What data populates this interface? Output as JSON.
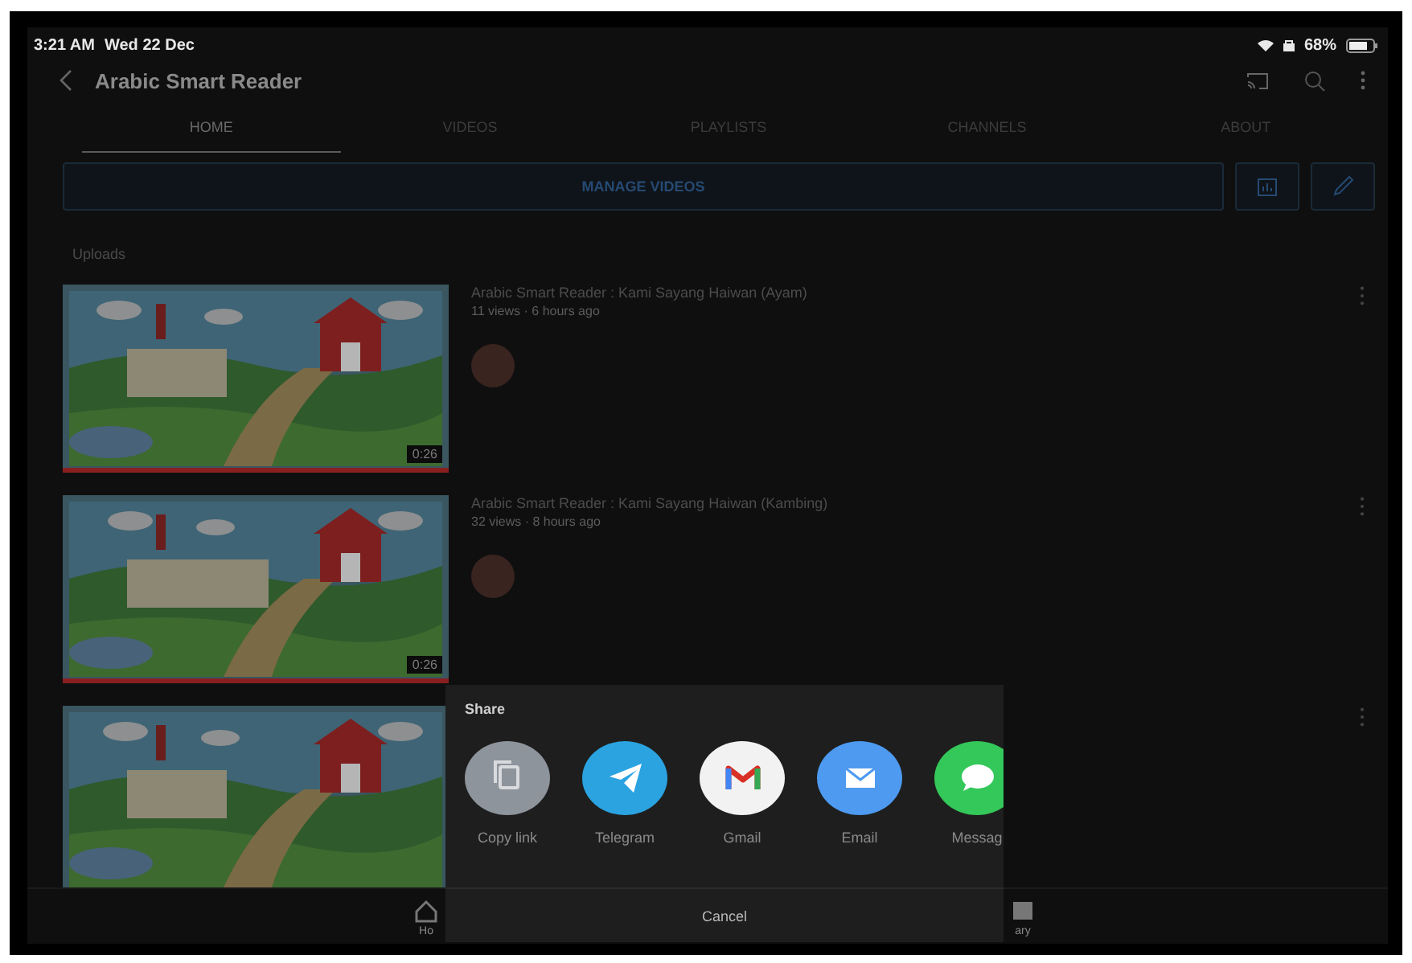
{
  "status_bar": {
    "time": "3:21 AM",
    "date": "Wed 22 Dec",
    "battery": "68%"
  },
  "header": {
    "title": "Arabic Smart Reader"
  },
  "tabs": [
    {
      "label": "HOME",
      "selected": true
    },
    {
      "label": "VIDEOS",
      "selected": false
    },
    {
      "label": "PLAYLISTS",
      "selected": false
    },
    {
      "label": "CHANNELS",
      "selected": false
    },
    {
      "label": "ABOUT",
      "selected": false
    }
  ],
  "manage_button": "MANAGE VIDEOS",
  "section_title": "Uploads",
  "videos": [
    {
      "title": "Arabic Smart Reader : Kami Sayang Haiwan (Ayam)",
      "meta": "11 views · 6 hours ago",
      "duration": "0:26",
      "kind": "picture"
    },
    {
      "title": "Arabic Smart Reader : Kami Sayang Haiwan (Kambing)",
      "meta": "32 views · 8 hours ago",
      "duration": "0:26",
      "kind": "picture"
    },
    {
      "kind": "picture"
    }
  ],
  "bottom_nav": [
    {
      "label": "Ho",
      "kind": "home"
    },
    {
      "label": "ary",
      "kind": "library"
    }
  ],
  "share_sheet": {
    "title": "Share",
    "targets": [
      {
        "label": "Copy link",
        "kind": "copy",
        "color": "#8e949c"
      },
      {
        "label": "Telegram",
        "kind": "telegram",
        "color": "#2aa3e0"
      },
      {
        "label": "Gmail",
        "kind": "gmail",
        "color": "#f2f2f2"
      },
      {
        "label": "Email",
        "kind": "email",
        "color": "#4d9af0"
      },
      {
        "label": "Messag",
        "kind": "message",
        "color": "#34c759"
      }
    ],
    "cancel": "Cancel"
  }
}
